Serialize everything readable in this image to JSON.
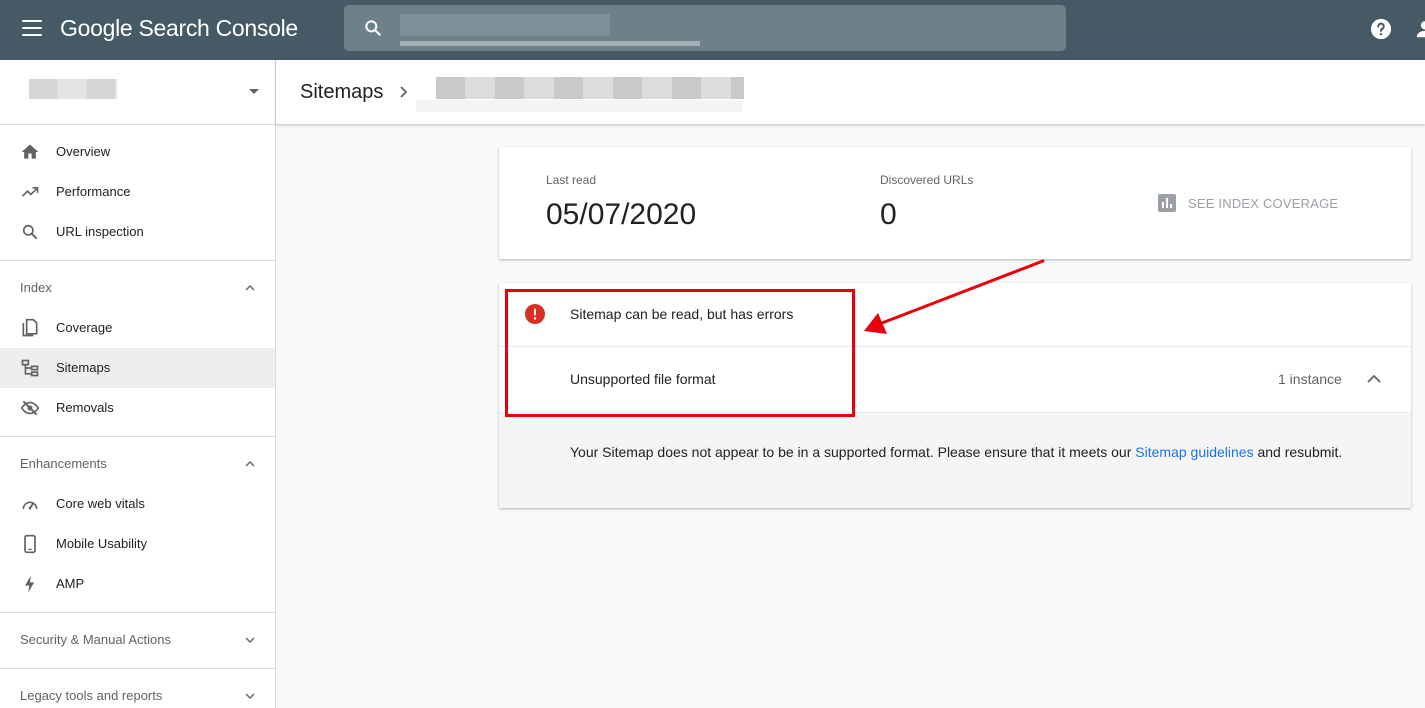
{
  "app": {
    "title": "Google Search Console"
  },
  "header": {
    "breadcrumb": "Sitemaps"
  },
  "sidebar": {
    "items": [
      {
        "label": "Overview",
        "icon": "home-icon"
      },
      {
        "label": "Performance",
        "icon": "trending-up-icon"
      },
      {
        "label": "URL inspection",
        "icon": "search-icon"
      },
      {
        "label": "Coverage",
        "icon": "copy-icon"
      },
      {
        "label": "Sitemaps",
        "icon": "sitemap-icon",
        "active": true
      },
      {
        "label": "Removals",
        "icon": "visibility-off-icon"
      },
      {
        "label": "Core web vitals",
        "icon": "speed-gauge-icon"
      },
      {
        "label": "Mobile Usability",
        "icon": "smartphone-icon"
      },
      {
        "label": "AMP",
        "icon": "bolt-icon"
      }
    ],
    "sections": [
      {
        "label": "Index",
        "expanded": true
      },
      {
        "label": "Enhancements",
        "expanded": true
      },
      {
        "label": "Security & Manual Actions",
        "expanded": false
      },
      {
        "label": "Legacy tools and reports",
        "expanded": false
      }
    ]
  },
  "summary": {
    "last_read_label": "Last read",
    "last_read_value": "05/07/2020",
    "discovered_label": "Discovered URLs",
    "discovered_value": "0",
    "see_coverage_label": "SEE INDEX COVERAGE"
  },
  "issue": {
    "status": "Sitemap can be read, but has errors",
    "type": "Unsupported file format",
    "instances": "1 instance",
    "detail_before": "Your Sitemap does not appear to be in a supported format. Please ensure that it meets our ",
    "detail_link": "Sitemap guidelines",
    "detail_after": " and resubmit."
  },
  "colors": {
    "topbar": "#455a64",
    "error": "#d93025",
    "link": "#1a73e8",
    "annotation": "#e8000b"
  }
}
